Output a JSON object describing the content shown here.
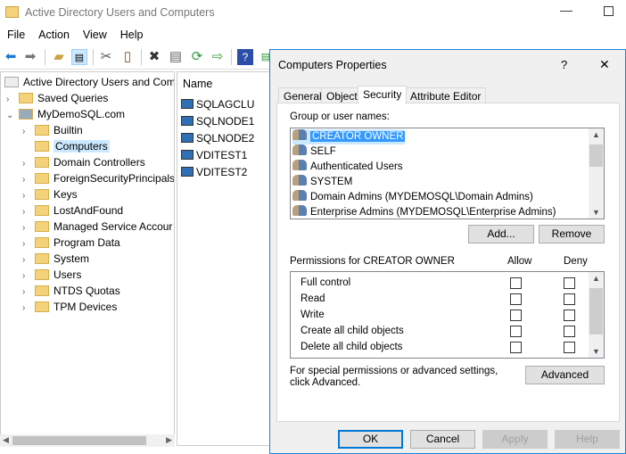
{
  "window": {
    "title": "Active Directory Users and Computers"
  },
  "menu": [
    "File",
    "Action",
    "View",
    "Help"
  ],
  "toolbar": [
    "back-icon",
    "forward-icon",
    "up-folder-icon",
    "show-hide-console-tree-icon",
    "cut-icon",
    "paste-icon",
    "delete-icon",
    "properties-icon",
    "refresh-icon",
    "export-list-icon",
    "help-icon",
    "action-pane-icon"
  ],
  "tree": {
    "root": "Active Directory Users and Com",
    "domain": "MyDemoSQL.com",
    "saved_queries": "Saved Queries",
    "items": [
      "Builtin",
      "Computers",
      "Domain Controllers",
      "ForeignSecurityPrincipals",
      "Keys",
      "LostAndFound",
      "Managed Service Accour",
      "Program Data",
      "System",
      "Users",
      "NTDS Quotas",
      "TPM Devices"
    ]
  },
  "list": {
    "header": "Name",
    "items": [
      "SQLAGCLU",
      "SQLNODE1",
      "SQLNODE2",
      "VDITEST1",
      "VDITEST2"
    ]
  },
  "dialog": {
    "title": "Computers Properties",
    "help": "?",
    "close": "✕",
    "tabs": [
      "General",
      "Object",
      "Security",
      "Attribute Editor"
    ],
    "group_label": "Group or user names:",
    "users": [
      "CREATOR OWNER",
      "SELF",
      "Authenticated Users",
      "SYSTEM",
      "Domain Admins (MYDEMOSQL\\Domain Admins)",
      "Enterprise Admins (MYDEMOSQL\\Enterprise Admins)"
    ],
    "add": "Add...",
    "remove": "Remove",
    "perm_label": "Permissions for CREATOR OWNER",
    "allow": "Allow",
    "deny": "Deny",
    "permissions": [
      "Full control",
      "Read",
      "Write",
      "Create all child objects",
      "Delete all child objects"
    ],
    "special": "For special permissions or advanced settings, click Advanced.",
    "advanced": "Advanced",
    "ok": "OK",
    "cancel": "Cancel",
    "apply": "Apply",
    "helpbtn": "Help"
  }
}
